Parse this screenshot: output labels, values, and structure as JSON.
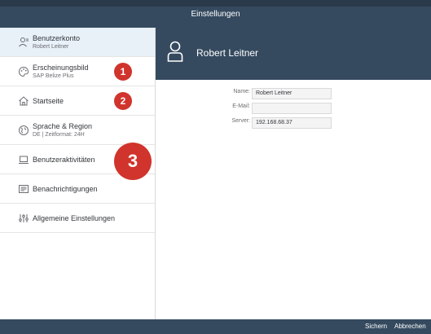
{
  "window": {
    "title": "Einstellungen"
  },
  "sidebar": {
    "items": [
      {
        "label": "Benutzerkonto",
        "sub": "Robert Leitner",
        "icon": "user-account-icon"
      },
      {
        "label": "Erscheinungsbild",
        "sub": "SAP Belize Plus",
        "icon": "palette-icon"
      },
      {
        "label": "Startseite",
        "sub": "",
        "icon": "home-icon"
      },
      {
        "label": "Sprache & Region",
        "sub": "DE | Zeitformat: 24H",
        "icon": "globe-icon"
      },
      {
        "label": "Benutzeraktivitäten",
        "sub": "",
        "icon": "laptop-icon"
      },
      {
        "label": "Benachrichtigungen",
        "sub": "",
        "icon": "list-icon"
      },
      {
        "label": "Allgemeine Einstellungen",
        "sub": "",
        "icon": "sliders-icon"
      }
    ]
  },
  "badges": [
    "1",
    "2",
    "3"
  ],
  "header": {
    "name": "Robert Leitner"
  },
  "form": {
    "name_label": "Name:",
    "name_value": "Robert Leitner",
    "email_label": "E-Mail:",
    "email_value": "",
    "server_label": "Server:",
    "server_value": "192.168.68.37"
  },
  "footer": {
    "save_label": "Sichern",
    "cancel_label": "Abbrechen"
  },
  "colors": {
    "header": "#354a5f",
    "badge": "#d0342c",
    "selected": "#e8f0f8"
  }
}
